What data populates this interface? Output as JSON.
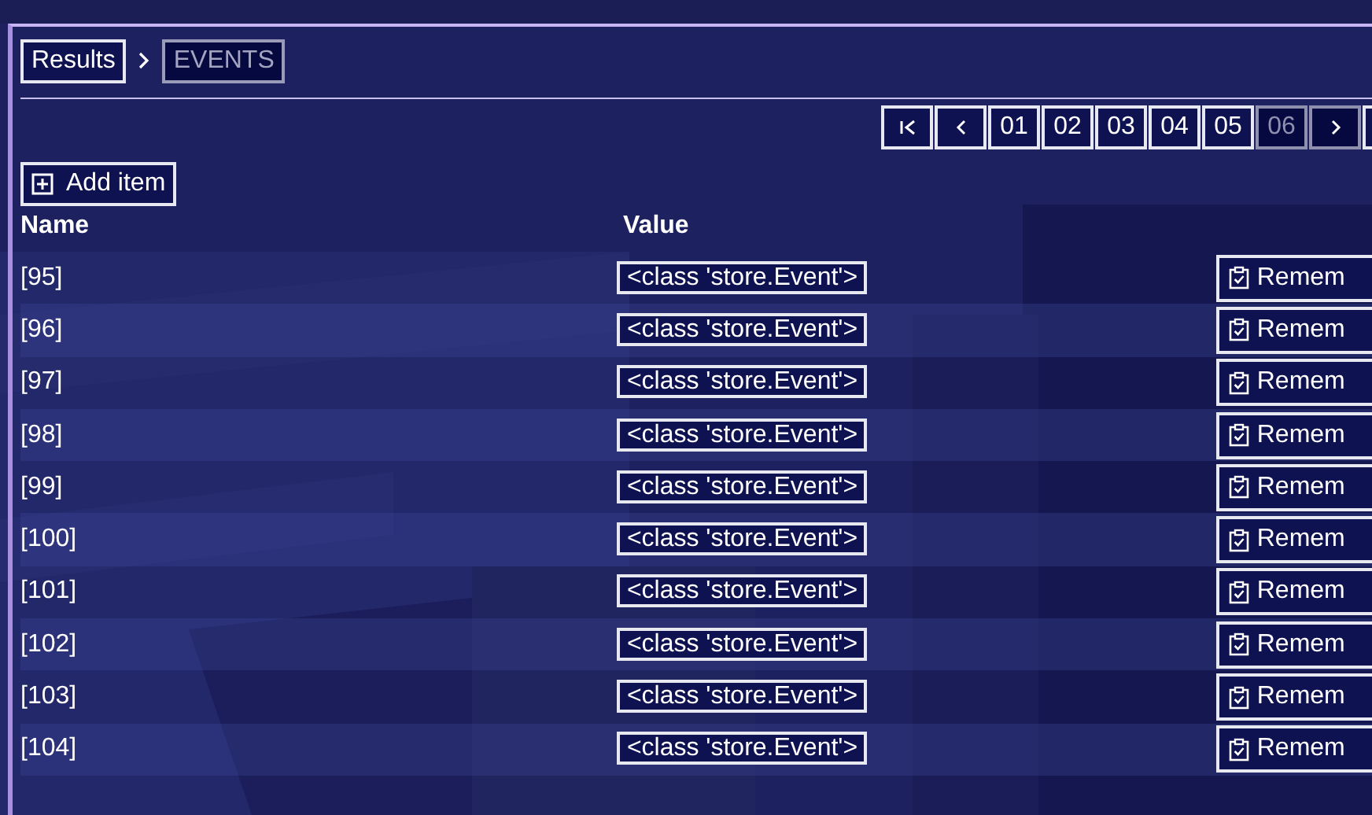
{
  "breadcrumb": [
    {
      "label": "Results",
      "selected": false
    },
    {
      "label": "EVENTS",
      "selected": true
    }
  ],
  "pagination": {
    "pages": [
      {
        "label": "01",
        "selected": false
      },
      {
        "label": "02",
        "selected": false
      },
      {
        "label": "03",
        "selected": false
      },
      {
        "label": "04",
        "selected": false
      },
      {
        "label": "05",
        "selected": false
      },
      {
        "label": "06",
        "selected": true
      }
    ]
  },
  "add_button": {
    "label": "Add item"
  },
  "table": {
    "columns": [
      "Name",
      "Value"
    ],
    "rows": [
      {
        "name": "[95]",
        "value": "<class 'store.Event'>",
        "action": "Remem"
      },
      {
        "name": "[96]",
        "value": "<class 'store.Event'>",
        "action": "Remem"
      },
      {
        "name": "[97]",
        "value": "<class 'store.Event'>",
        "action": "Remem"
      },
      {
        "name": "[98]",
        "value": "<class 'store.Event'>",
        "action": "Remem"
      },
      {
        "name": "[99]",
        "value": "<class 'store.Event'>",
        "action": "Remem"
      },
      {
        "name": "[100]",
        "value": "<class 'store.Event'>",
        "action": "Remem"
      },
      {
        "name": "[101]",
        "value": "<class 'store.Event'>",
        "action": "Remem"
      },
      {
        "name": "[102]",
        "value": "<class 'store.Event'>",
        "action": "Remem"
      },
      {
        "name": "[103]",
        "value": "<class 'store.Event'>",
        "action": "Remem"
      },
      {
        "name": "[104]",
        "value": "<class 'store.Event'>",
        "action": "Remem"
      }
    ]
  }
}
